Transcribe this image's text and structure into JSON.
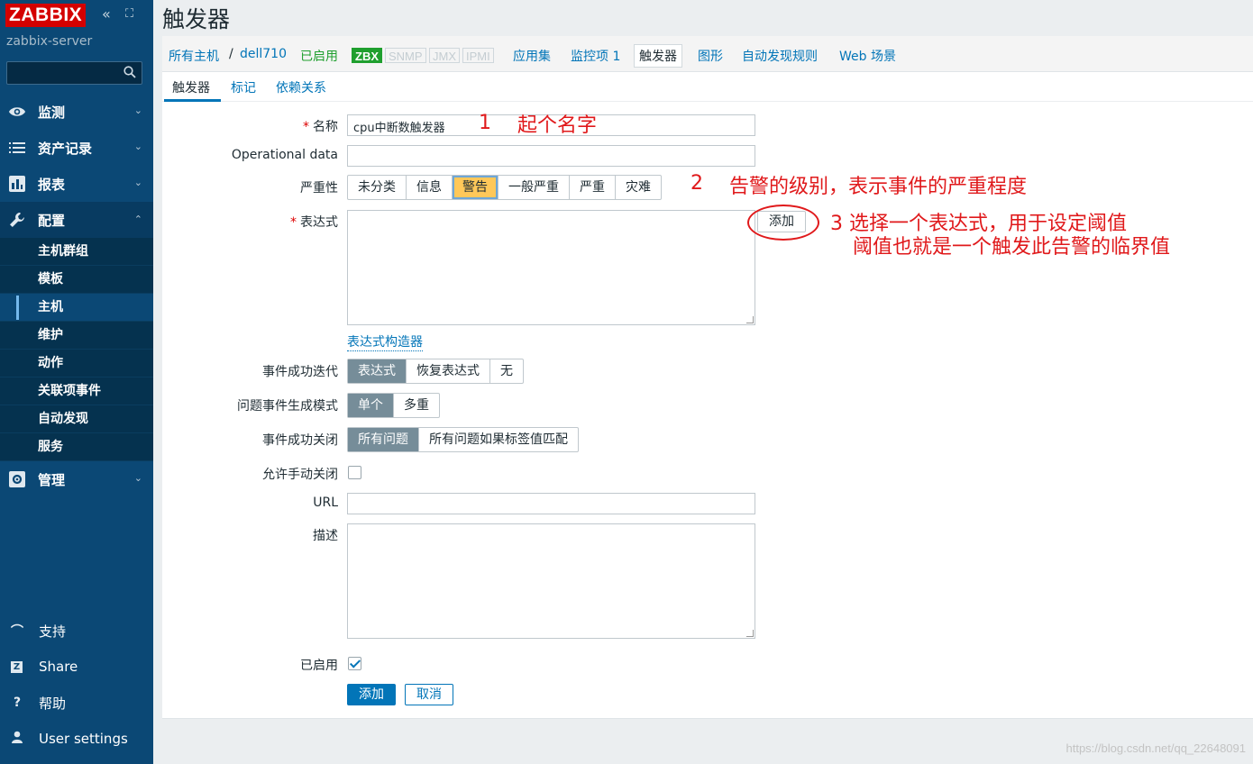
{
  "sidebar": {
    "logo": "ZABBIX",
    "collapse_glyph": "«",
    "kiosk_glyph": "⛶",
    "server": "zabbix-server",
    "search_placeholder": "",
    "menu": [
      {
        "label": "监测",
        "icon": "eye-icon"
      },
      {
        "label": "资产记录",
        "icon": "list-icon"
      },
      {
        "label": "报表",
        "icon": "bar-chart-icon"
      },
      {
        "label": "配置",
        "icon": "wrench-icon"
      },
      {
        "label": "管理",
        "icon": "gear-icon"
      }
    ],
    "submenu": [
      "主机群组",
      "模板",
      "主机",
      "维护",
      "动作",
      "关联项事件",
      "自动发现",
      "服务"
    ],
    "submenu_active": "主机",
    "bottom": [
      {
        "label": "支持",
        "icon": "headset-icon",
        "glyph": "⌒"
      },
      {
        "label": "Share",
        "icon": "share-z-icon",
        "glyph": "Z"
      },
      {
        "label": "帮助",
        "icon": "help-icon",
        "glyph": "?"
      },
      {
        "label": "User settings",
        "icon": "user-icon",
        "glyph": "●"
      }
    ]
  },
  "header": {
    "title": "触发器"
  },
  "nav": {
    "all_hosts": "所有主机",
    "sep": "/",
    "host": "dell710",
    "status": "已启用",
    "protocols": [
      "ZBX",
      "SNMP",
      "JMX",
      "IPMI"
    ],
    "applications": "应用集",
    "items": "监控项 1",
    "triggers": "触发器",
    "graphs": "图形",
    "discovery": "自动发现规则",
    "web": "Web 场景"
  },
  "tabs": [
    "触发器",
    "标记",
    "依赖关系"
  ],
  "form": {
    "name_label": "名称",
    "name_value": "cpu中断数触发器",
    "opdata_label": "Operational data",
    "opdata_value": "",
    "severity_label": "严重性",
    "severity_options": [
      "未分类",
      "信息",
      "警告",
      "一般严重",
      "严重",
      "灾难"
    ],
    "severity_selected": "警告",
    "expression_label": "表达式",
    "expression_value": "",
    "add_expr_button": "添加",
    "expr_constructor": "表达式构造器",
    "ok_event_gen_label": "事件成功迭代",
    "ok_event_gen_options": [
      "表达式",
      "恢复表达式",
      "无"
    ],
    "ok_event_gen_selected": "表达式",
    "problem_mode_label": "问题事件生成模式",
    "problem_mode_options": [
      "单个",
      "多重"
    ],
    "problem_mode_selected": "单个",
    "ok_close_label": "事件成功关闭",
    "ok_close_options": [
      "所有问题",
      "所有问题如果标签值匹配"
    ],
    "ok_close_selected": "所有问题",
    "manual_close_label": "允许手动关闭",
    "manual_close_checked": false,
    "url_label": "URL",
    "url_value": "",
    "desc_label": "描述",
    "desc_value": "",
    "enabled_label": "已启用",
    "enabled_checked": true,
    "submit_button": "添加",
    "cancel_button": "取消"
  },
  "annotations": {
    "a1_num": "1",
    "a1_text": "起个名字",
    "a2_num": "2",
    "a2_text": "告警的级别，表示事件的严重程度",
    "a3_line1": "3  选择一个表达式，用于设定阈值",
    "a3_line2": "阈值也就是一个触发此告警的临界值",
    "annotation_color": "#e0191b"
  },
  "watermark": "https://blog.csdn.net/qq_22648091"
}
